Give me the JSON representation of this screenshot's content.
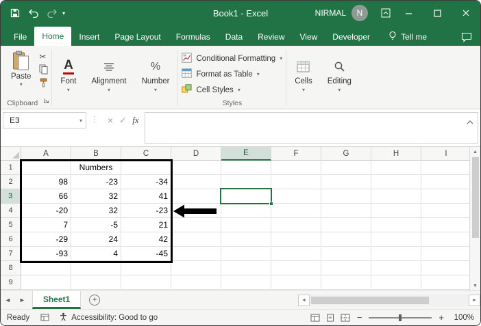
{
  "titlebar": {
    "title": "Book1 - Excel",
    "user_name": "NIRMAL",
    "avatar_letter": "N"
  },
  "ribbon_tabs": [
    {
      "label": "File",
      "active": false
    },
    {
      "label": "Home",
      "active": true
    },
    {
      "label": "Insert",
      "active": false
    },
    {
      "label": "Page Layout",
      "active": false
    },
    {
      "label": "Formulas",
      "active": false
    },
    {
      "label": "Data",
      "active": false
    },
    {
      "label": "Review",
      "active": false
    },
    {
      "label": "View",
      "active": false
    },
    {
      "label": "Developer",
      "active": false
    }
  ],
  "tell_me_label": "Tell me",
  "ribbon": {
    "paste_label": "Paste",
    "clipboard_group_label": "Clipboard",
    "font_group_label": "Font",
    "alignment_group_label": "Alignment",
    "number_group_label": "Number",
    "conditional_formatting_label": "Conditional Formatting",
    "format_as_table_label": "Format as Table",
    "cell_styles_label": "Cell Styles",
    "styles_group_label": "Styles",
    "cells_group_label": "Cells",
    "editing_group_label": "Editing"
  },
  "formula_bar": {
    "name_box_value": "E3",
    "fx_label": "fx",
    "formula_value": ""
  },
  "grid": {
    "columns": [
      "A",
      "B",
      "C",
      "D",
      "E",
      "F",
      "G",
      "H",
      "I"
    ],
    "row_numbers": [
      "1",
      "2",
      "3",
      "4",
      "5",
      "6",
      "7",
      "8",
      "9"
    ],
    "selected_cell": "E3",
    "selected_column": "E",
    "selected_row": "3",
    "cells": {
      "B1": "Numbers",
      "A2": "98",
      "B2": "-23",
      "C2": "-34",
      "A3": "66",
      "B3": "32",
      "C3": "41",
      "A4": "-20",
      "B4": "32",
      "C4": "-23",
      "A5": "7",
      "B5": "-5",
      "C5": "21",
      "A6": "-29",
      "B6": "24",
      "C6": "42",
      "A7": "-93",
      "B7": "4",
      "C7": "-45"
    }
  },
  "sheet_bar": {
    "active_sheet_label": "Sheet1"
  },
  "status_bar": {
    "mode_label": "Ready",
    "accessibility_label": "Accessibility: Good to go",
    "zoom_label": "100%"
  },
  "colors": {
    "excel_green": "#217346",
    "table_border_color": "#000000",
    "selection_color": "#217346"
  }
}
